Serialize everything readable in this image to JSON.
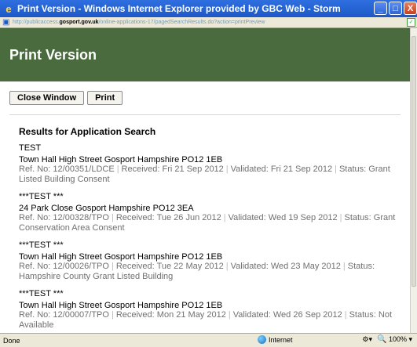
{
  "window": {
    "title": "Print Version - Windows Internet Explorer provided by GBC Web - Storm",
    "minimize": "_",
    "maximize": "□",
    "close": "X"
  },
  "address": {
    "prefix": "http://publicaccess.",
    "domain": "gosport.gov.uk",
    "path": "/online-applications-17/pagedSearchResults.do?action=printPreview"
  },
  "page": {
    "heading": "Print Version",
    "close_window_label": "Close Window",
    "print_label": "Print",
    "results_title": "Results for Application Search"
  },
  "results": [
    {
      "title": "TEST",
      "address": "Town Hall High Street Gosport Hampshire PO12 1EB",
      "ref": "Ref. No: 12/00351/LDCE",
      "received": "Received: Fri 21 Sep 2012",
      "validated": "Validated: Fri 21 Sep 2012",
      "status": "Status: Grant Listed Building Consent"
    },
    {
      "title": "***TEST ***",
      "address": "24 Park Close Gosport Hampshire PO12 3EA",
      "ref": "Ref. No: 12/00328/TPO",
      "received": "Received: Tue 26 Jun 2012",
      "validated": "Validated: Wed 19 Sep 2012",
      "status": "Status: Grant Conservation Area Consent"
    },
    {
      "title": "***TEST ***",
      "address": "Town Hall High Street Gosport Hampshire PO12 1EB",
      "ref": "Ref. No: 12/00026/TPO",
      "received": "Received: Tue 22 May 2012",
      "validated": "Validated: Wed 23 May 2012",
      "status": "Status: Hampshire County Grant Listed Building"
    },
    {
      "title": "***TEST ***",
      "address": "Town Hall High Street Gosport Hampshire PO12 1EB",
      "ref": "Ref. No: 12/00007/TPO",
      "received": "Received: Mon 21 May 2012",
      "validated": "Validated: Wed 26 Sep 2012",
      "status": "Status: Not Available"
    }
  ],
  "status_bar": {
    "left": "Done",
    "zone": "Internet",
    "zoom": "100%"
  },
  "colors": {
    "banner": "#4a6b3e",
    "titlebar": "#1d58c8"
  },
  "icons": {
    "app": "ie-logo-icon",
    "zone": "globe-icon"
  }
}
